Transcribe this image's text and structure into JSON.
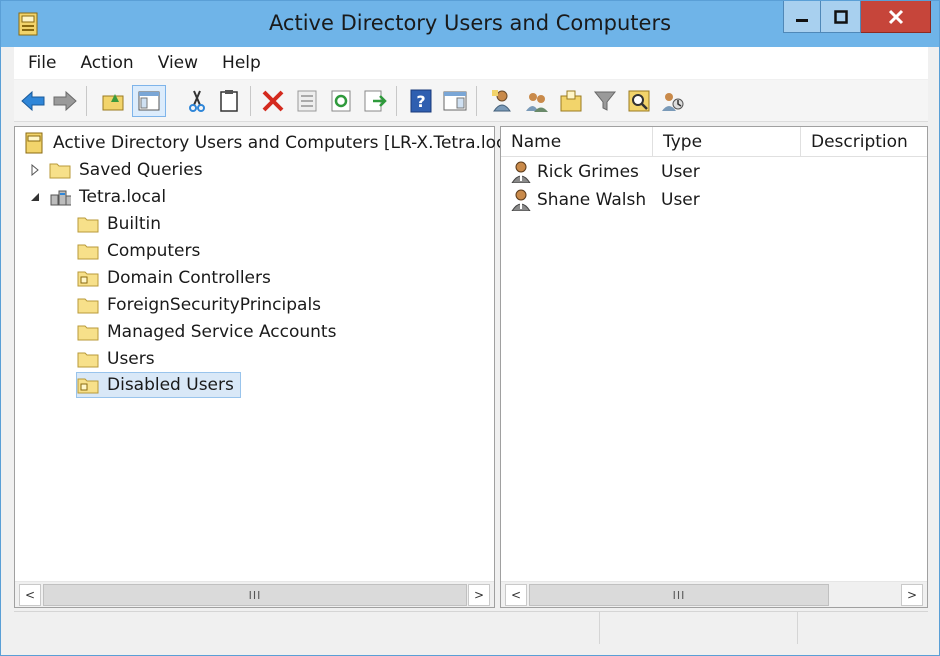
{
  "window": {
    "title": "Active Directory Users and Computers"
  },
  "menu": [
    "File",
    "Action",
    "View",
    "Help"
  ],
  "toolbar": {
    "icons": [
      "back-icon",
      "forward-icon",
      "up-folder-icon",
      "show-tree-icon",
      "cut-icon",
      "paste-icon",
      "delete-icon",
      "properties-icon",
      "refresh-icon",
      "export-icon",
      "help-icon",
      "console-pane-icon",
      "new-user-icon",
      "new-group-icon",
      "new-ou-icon",
      "filter-icon",
      "find-icon",
      "delegate-icon"
    ]
  },
  "tree": {
    "root": "Active Directory Users and Computers [LR-X.Tetra.local]",
    "saved_queries": "Saved Queries",
    "domain": "Tetra.local",
    "children": [
      "Builtin",
      "Computers",
      "Domain Controllers",
      "ForeignSecurityPrincipals",
      "Managed Service Accounts",
      "Users",
      "Disabled Users"
    ]
  },
  "list": {
    "columns": [
      "Name",
      "Type",
      "Description"
    ],
    "rows": [
      {
        "name": "Rick Grimes",
        "type": "User"
      },
      {
        "name": "Shane Walsh",
        "type": "User"
      }
    ]
  },
  "scrollbar": {
    "thumb_label": "III",
    "left_arrow": "<",
    "right_arrow": ">"
  },
  "colors": {
    "titlebar": "#6fb4e8",
    "close": "#c6453a",
    "selection": "#d9e8f7"
  }
}
